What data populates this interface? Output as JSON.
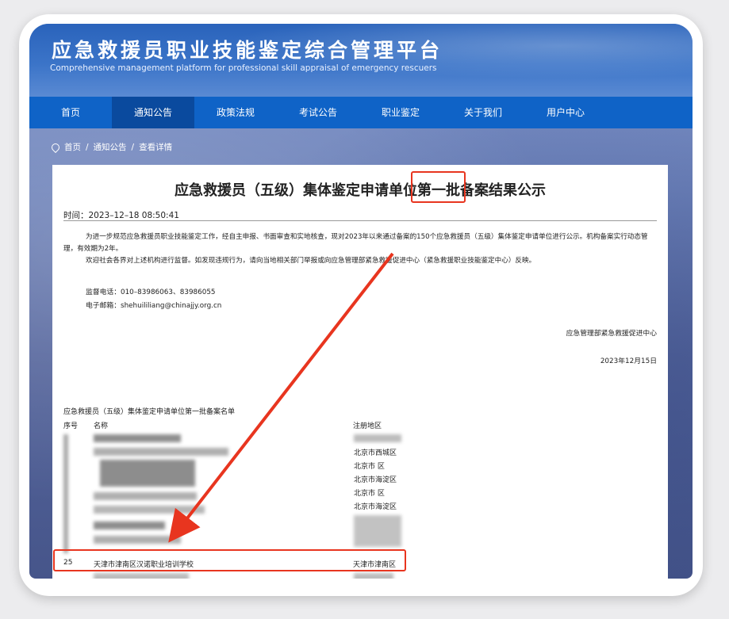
{
  "site": {
    "title": "应急救援员职业技能鉴定综合管理平台",
    "subtitle": "Comprehensive management platform for professional skill appraisal of emergency rescuers"
  },
  "nav": [
    {
      "label": "首页"
    },
    {
      "label": "通知公告"
    },
    {
      "label": "政策法规"
    },
    {
      "label": "考试公告"
    },
    {
      "label": "职业鉴定"
    },
    {
      "label": "关于我们"
    },
    {
      "label": "用户中心"
    }
  ],
  "breadcrumb": {
    "home": "首页",
    "section": "通知公告",
    "current": "查看详情",
    "sep": "/"
  },
  "article": {
    "title": "应急救援员（五级）集体鉴定申请单位第一批备案结果公示",
    "time": "时间：2023–12–18 08:50:41",
    "para1": "为进一步规范应急救援员职业技能鉴定工作，经自主申报、书面审查和实地核查，现对2023年以来通过备案的150个应急救援员（五级）集体鉴定申请单位进行公示。机构备案实行动态管理，有效期为2年。",
    "para2": "欢迎社会各界对上述机构进行监督。如发现违规行为，请向当地相关部门举报或向应急管理部紧急救援促进中心（紧急救援职业技能鉴定中心）反映。",
    "phone": "监督电话：010–83986063、83986055",
    "email": "电子邮箱：shehuililiang@chinajjy.org.cn",
    "signer": "应急管理部紧急救援促进中心",
    "date": "2023年12月15日"
  },
  "list": {
    "caption": "应急救援员（五级）集体鉴定申请单位第一批备案名单",
    "col_no": "序号",
    "col_name": "名称",
    "col_region": "注册地区",
    "visible_regions": [
      "北京市西城区",
      "北京市  区",
      "北京市海淀区",
      "北京市  区",
      "北京市海淀区"
    ],
    "highlighted_row": {
      "no": "25",
      "name": "天津市津南区汉诺职业培训学校",
      "region": "天津市津南区"
    }
  },
  "annotation_color": "#e8351f"
}
